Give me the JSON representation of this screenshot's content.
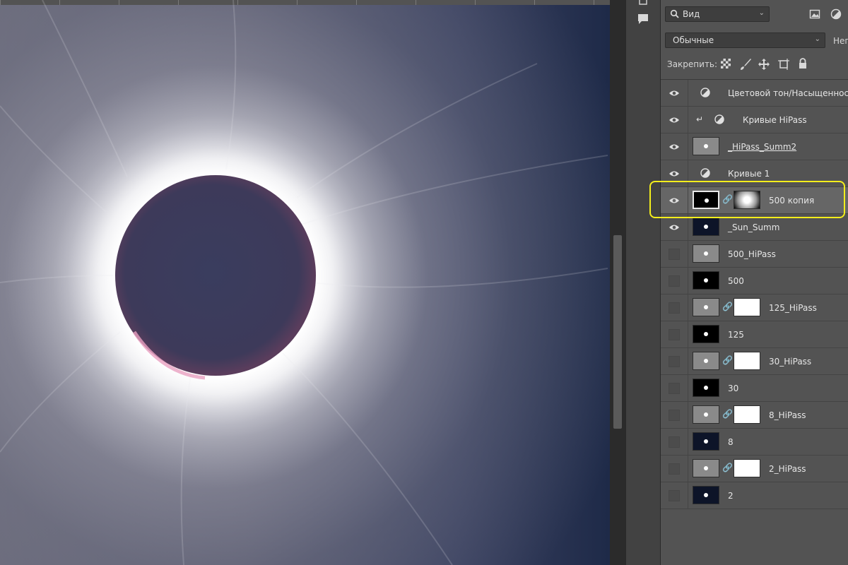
{
  "colors": {
    "highlight": "#f4ee1c",
    "panel_bg": "#535353",
    "selected_row": "#666666"
  },
  "icon_column": {
    "icons": [
      "tool-presets-icon",
      "comment-icon"
    ]
  },
  "layers_panel": {
    "filter": {
      "label": "Вид",
      "icon": "search-icon"
    },
    "filter_icons": [
      "image-filter-icon",
      "adjustment-filter-icon"
    ],
    "blend_mode": "Обычные",
    "opacity_label": "Неп",
    "lock_label": "Закрепить:",
    "lock_icons": [
      "lock-transparent-icon",
      "lock-pixels-icon",
      "lock-position-icon",
      "lock-artboard-icon",
      "lock-all-icon"
    ],
    "layers": [
      {
        "name": "Цветовой тон/Насыщенность",
        "visible": true,
        "kind": "adjustment"
      },
      {
        "name": "Кривые HiPass",
        "visible": true,
        "kind": "adjustment-clipped"
      },
      {
        "name": "_HiPass_Summ2",
        "visible": true,
        "kind": "pixel-gray"
      },
      {
        "name": "Кривые 1",
        "visible": true,
        "kind": "adjustment"
      },
      {
        "name": "500 копия",
        "visible": true,
        "kind": "pixel-black-mask-gradient",
        "selected": true
      },
      {
        "name": "_Sun_Summ",
        "visible": true,
        "kind": "pixel-blue"
      },
      {
        "name": "500_HiPass",
        "visible": false,
        "kind": "pixel-gray"
      },
      {
        "name": "500",
        "visible": false,
        "kind": "pixel-black"
      },
      {
        "name": "125_HiPass",
        "visible": false,
        "kind": "pixel-gray-mask"
      },
      {
        "name": "125",
        "visible": false,
        "kind": "pixel-black"
      },
      {
        "name": "30_HiPass",
        "visible": false,
        "kind": "pixel-gray-mask"
      },
      {
        "name": "30",
        "visible": false,
        "kind": "pixel-black"
      },
      {
        "name": "8_HiPass",
        "visible": false,
        "kind": "pixel-gray-mask"
      },
      {
        "name": "8",
        "visible": false,
        "kind": "pixel-blue"
      },
      {
        "name": "2_HiPass",
        "visible": false,
        "kind": "pixel-gray-mask"
      },
      {
        "name": "2",
        "visible": false,
        "kind": "pixel-blue"
      }
    ]
  }
}
